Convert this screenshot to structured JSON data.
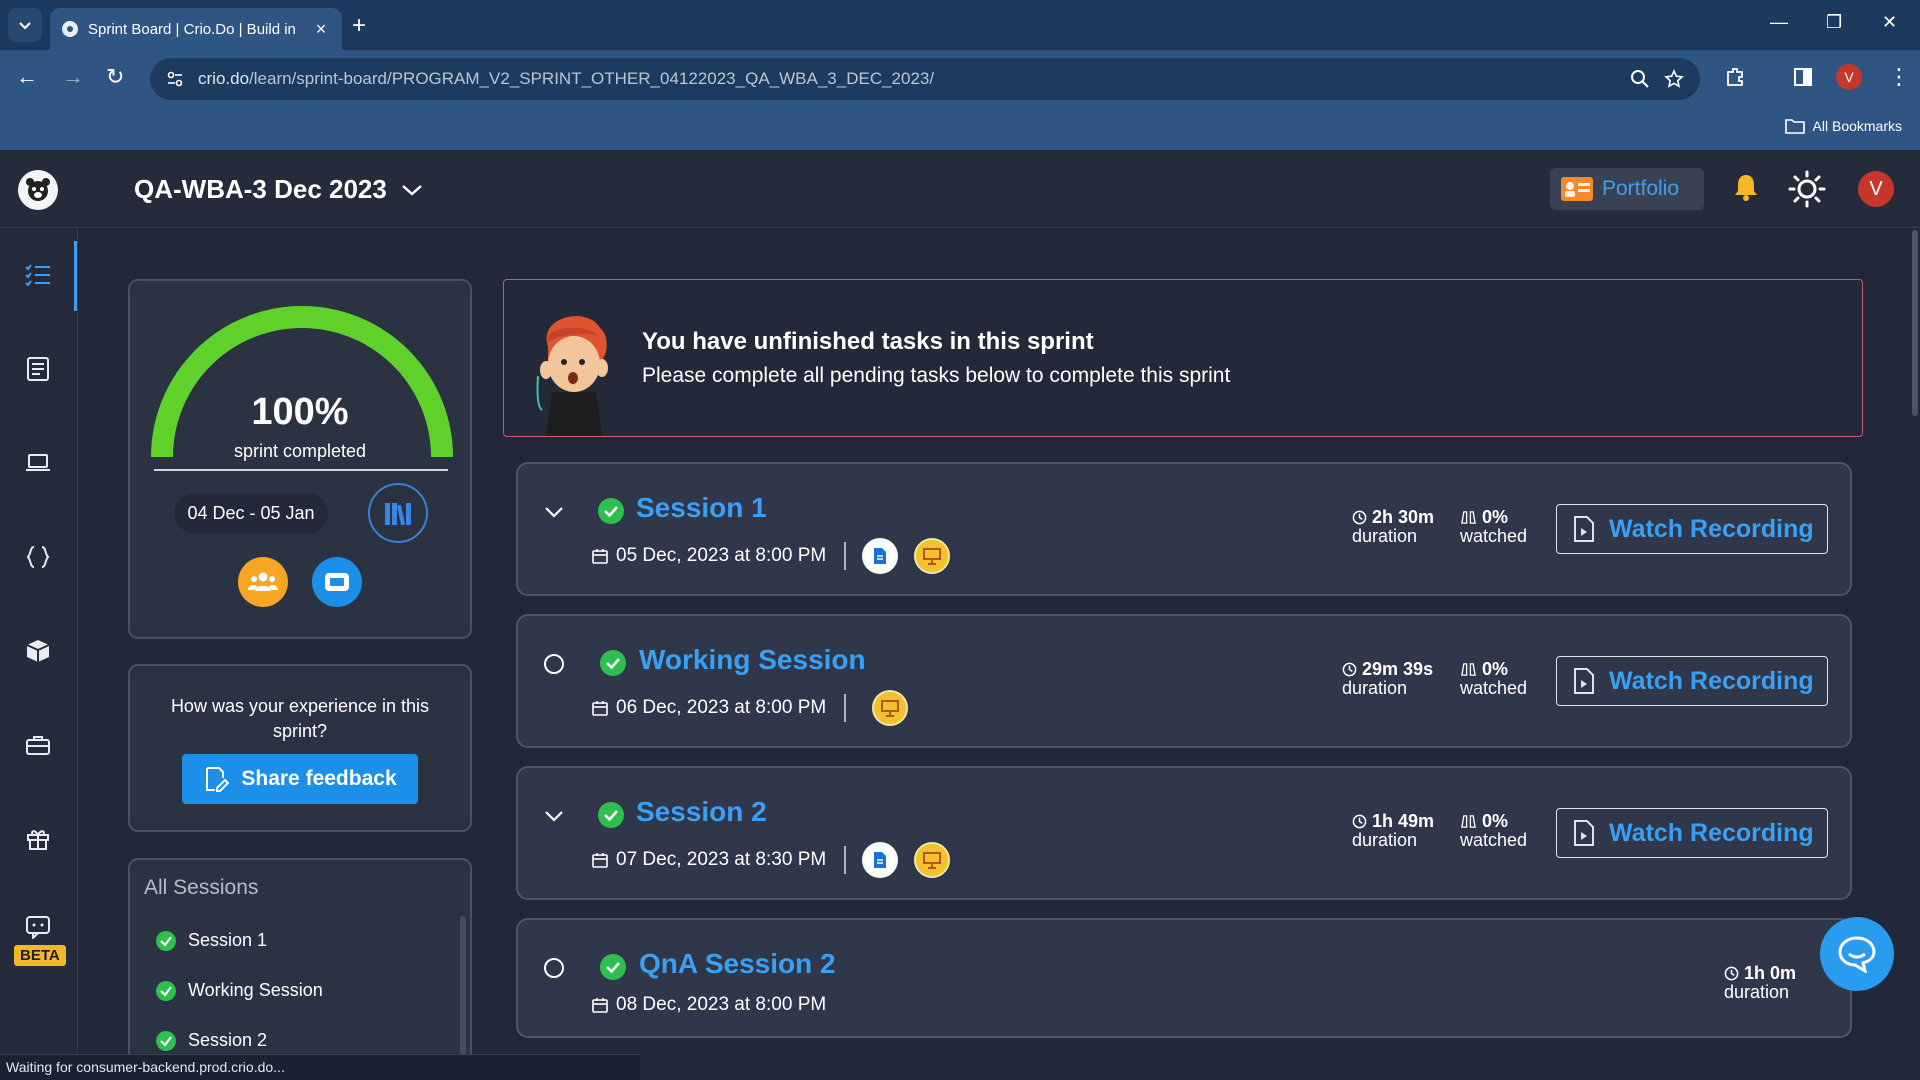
{
  "browser": {
    "tab_title": "Sprint Board | Crio.Do | Build in",
    "url_host": "crio.do",
    "url_path": "/learn/sprint-board/PROGRAM_V2_SPRINT_OTHER_04122023_QA_WBA_3_DEC_2023/",
    "all_bookmarks": "All Bookmarks",
    "profile_initial": "V",
    "status_text": "Waiting for consumer-backend.prod.crio.do..."
  },
  "header": {
    "sprint_title": "QA-WBA-3 Dec 2023",
    "portfolio_label": "Portfolio",
    "avatar_initial": "V"
  },
  "rail": {
    "beta_label": "BETA"
  },
  "progress": {
    "percent": "100%",
    "percent_value": 1.0,
    "caption": "sprint completed",
    "date_range": "04 Dec - 05 Jan"
  },
  "feedback": {
    "question": "How was your experience in this sprint?",
    "button_label": "Share feedback"
  },
  "all_sessions": {
    "title": "All Sessions",
    "items": [
      "Session 1",
      "Working Session",
      "Session 2"
    ]
  },
  "alert": {
    "title": "You have unfinished tasks in this sprint",
    "description": "Please complete all pending tasks below to complete this sprint"
  },
  "sessions": [
    {
      "title": "Session 1",
      "date": "05 Dec, 2023 at 8:00 PM",
      "duration": "2h 30m",
      "duration_label": "duration",
      "watched": "0%",
      "watched_label": "watched",
      "button": "Watch Recording"
    },
    {
      "title": "Working Session",
      "date": "06 Dec, 2023 at 8:00 PM",
      "duration": "29m 39s",
      "duration_label": "duration",
      "watched": "0%",
      "watched_label": "watched",
      "button": "Watch Recording"
    },
    {
      "title": "Session 2",
      "date": "07 Dec, 2023 at 8:30 PM",
      "duration": "1h 49m",
      "duration_label": "duration",
      "watched": "0%",
      "watched_label": "watched",
      "button": "Watch Recording"
    },
    {
      "title": "QnA Session 2",
      "date": "08 Dec, 2023 at 8:00 PM",
      "duration": "1h 0m",
      "duration_label": "duration"
    }
  ],
  "colors": {
    "accent": "#3aa0f5",
    "success": "#2fbf4e",
    "warning": "#f2c12e",
    "alert_border": "#c95a6f"
  }
}
